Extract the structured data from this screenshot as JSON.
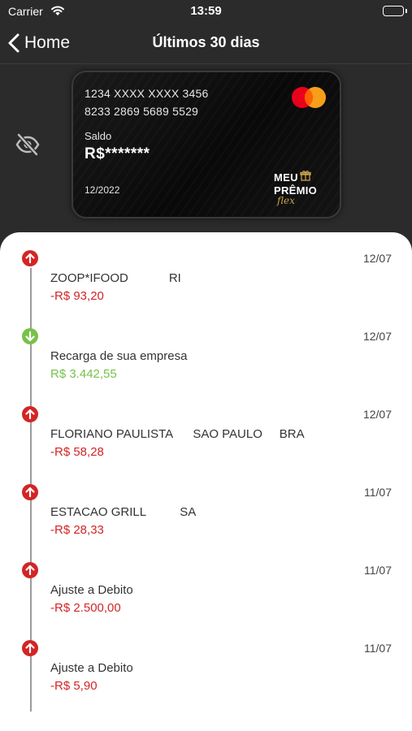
{
  "status": {
    "carrier": "Carrier",
    "time": "13:59"
  },
  "nav": {
    "back_label": "Home",
    "title": "Últimos 30 dias"
  },
  "card": {
    "masked_number": "1234 XXXX XXXX 3456",
    "full_number": "8233 2869 5689 5529",
    "balance_label": "Saldo",
    "balance_value": "R$*******",
    "expiry": "12/2022",
    "brand_line1": "MEU",
    "brand_line2": "PRÊMIO",
    "brand_line3": "flex",
    "network": "mastercard"
  },
  "colors": {
    "debit": "#d32525",
    "credit": "#78c14a",
    "background": "#2b2b2b"
  },
  "transactions": [
    {
      "date": "12/07",
      "description": "ZOOP*IFOOD            RI",
      "amount": "-R$ 93,20",
      "type": "debit"
    },
    {
      "date": "12/07",
      "description": "Recarga de sua empresa",
      "amount": "R$ 3.442,55",
      "type": "credit"
    },
    {
      "date": "12/07",
      "description": "FLORIANO PAULISTA      SAO PAULO     BRA",
      "amount": "-R$ 58,28",
      "type": "debit"
    },
    {
      "date": "11/07",
      "description": "ESTACAO GRILL          SA",
      "amount": "-R$ 28,33",
      "type": "debit"
    },
    {
      "date": "11/07",
      "description": "Ajuste a Debito",
      "amount": "-R$ 2.500,00",
      "type": "debit"
    },
    {
      "date": "11/07",
      "description": "Ajuste a Debito",
      "amount": "-R$ 5,90",
      "type": "debit"
    }
  ]
}
